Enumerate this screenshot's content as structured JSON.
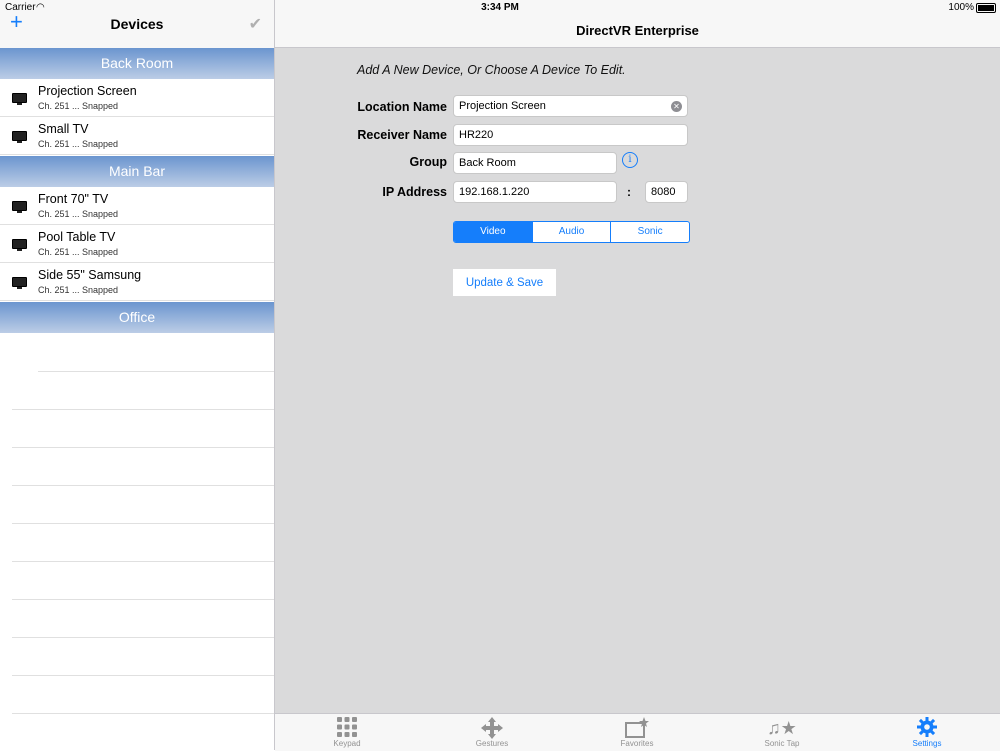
{
  "status_bar": {
    "carrier": "Carrier",
    "time": "3:34 PM",
    "battery": "100%"
  },
  "left_nav": {
    "title": "Devices",
    "add_icon": "plus-icon",
    "done_icon": "checkmark-icon"
  },
  "groups": [
    {
      "name": "Back Room",
      "devices": [
        {
          "name": "Projection Screen",
          "status": "Ch. 251 ... Snapped"
        },
        {
          "name": "Small TV",
          "status": "Ch. 251 ... Snapped"
        }
      ]
    },
    {
      "name": "Main Bar",
      "devices": [
        {
          "name": "Front 70\" TV",
          "status": "Ch. 251 ... Snapped"
        },
        {
          "name": "Pool Table TV",
          "status": "Ch. 251 ... Snapped"
        },
        {
          "name": "Side 55\" Samsung",
          "status": "Ch. 251 ... Snapped"
        }
      ]
    },
    {
      "name": "Office",
      "devices": []
    }
  ],
  "right_nav": {
    "title": "DirectVR Enterprise"
  },
  "form": {
    "instructions": "Add A New Device, Or Choose A Device To Edit.",
    "location_label": "Location Name",
    "location_value": "Projection Screen",
    "receiver_label": "Receiver Name",
    "receiver_value": "HR220",
    "group_label": "Group",
    "group_value": "Back Room",
    "ip_label": "IP Address",
    "ip_value": "192.168.1.220",
    "port_separator": ":",
    "port_value": "8080",
    "segments": [
      "Video",
      "Audio",
      "Sonic"
    ],
    "selected_segment": "Video",
    "save_label": "Update & Save"
  },
  "tab_bar": {
    "tabs": [
      {
        "label": "Keypad",
        "icon": "keypad-grid-icon"
      },
      {
        "label": "Gestures",
        "icon": "move-arrows-icon"
      },
      {
        "label": "Favorites",
        "icon": "favorites-star-icon"
      },
      {
        "label": "Sonic Tap",
        "icon": "music-note-star-icon"
      },
      {
        "label": "Settings",
        "icon": "gear-icon"
      }
    ],
    "active": "Settings"
  },
  "colors": {
    "accent": "#157efb",
    "section_header_top": "#6b95cf",
    "section_header_bottom": "#bccde6",
    "detail_background": "#dadadb"
  }
}
